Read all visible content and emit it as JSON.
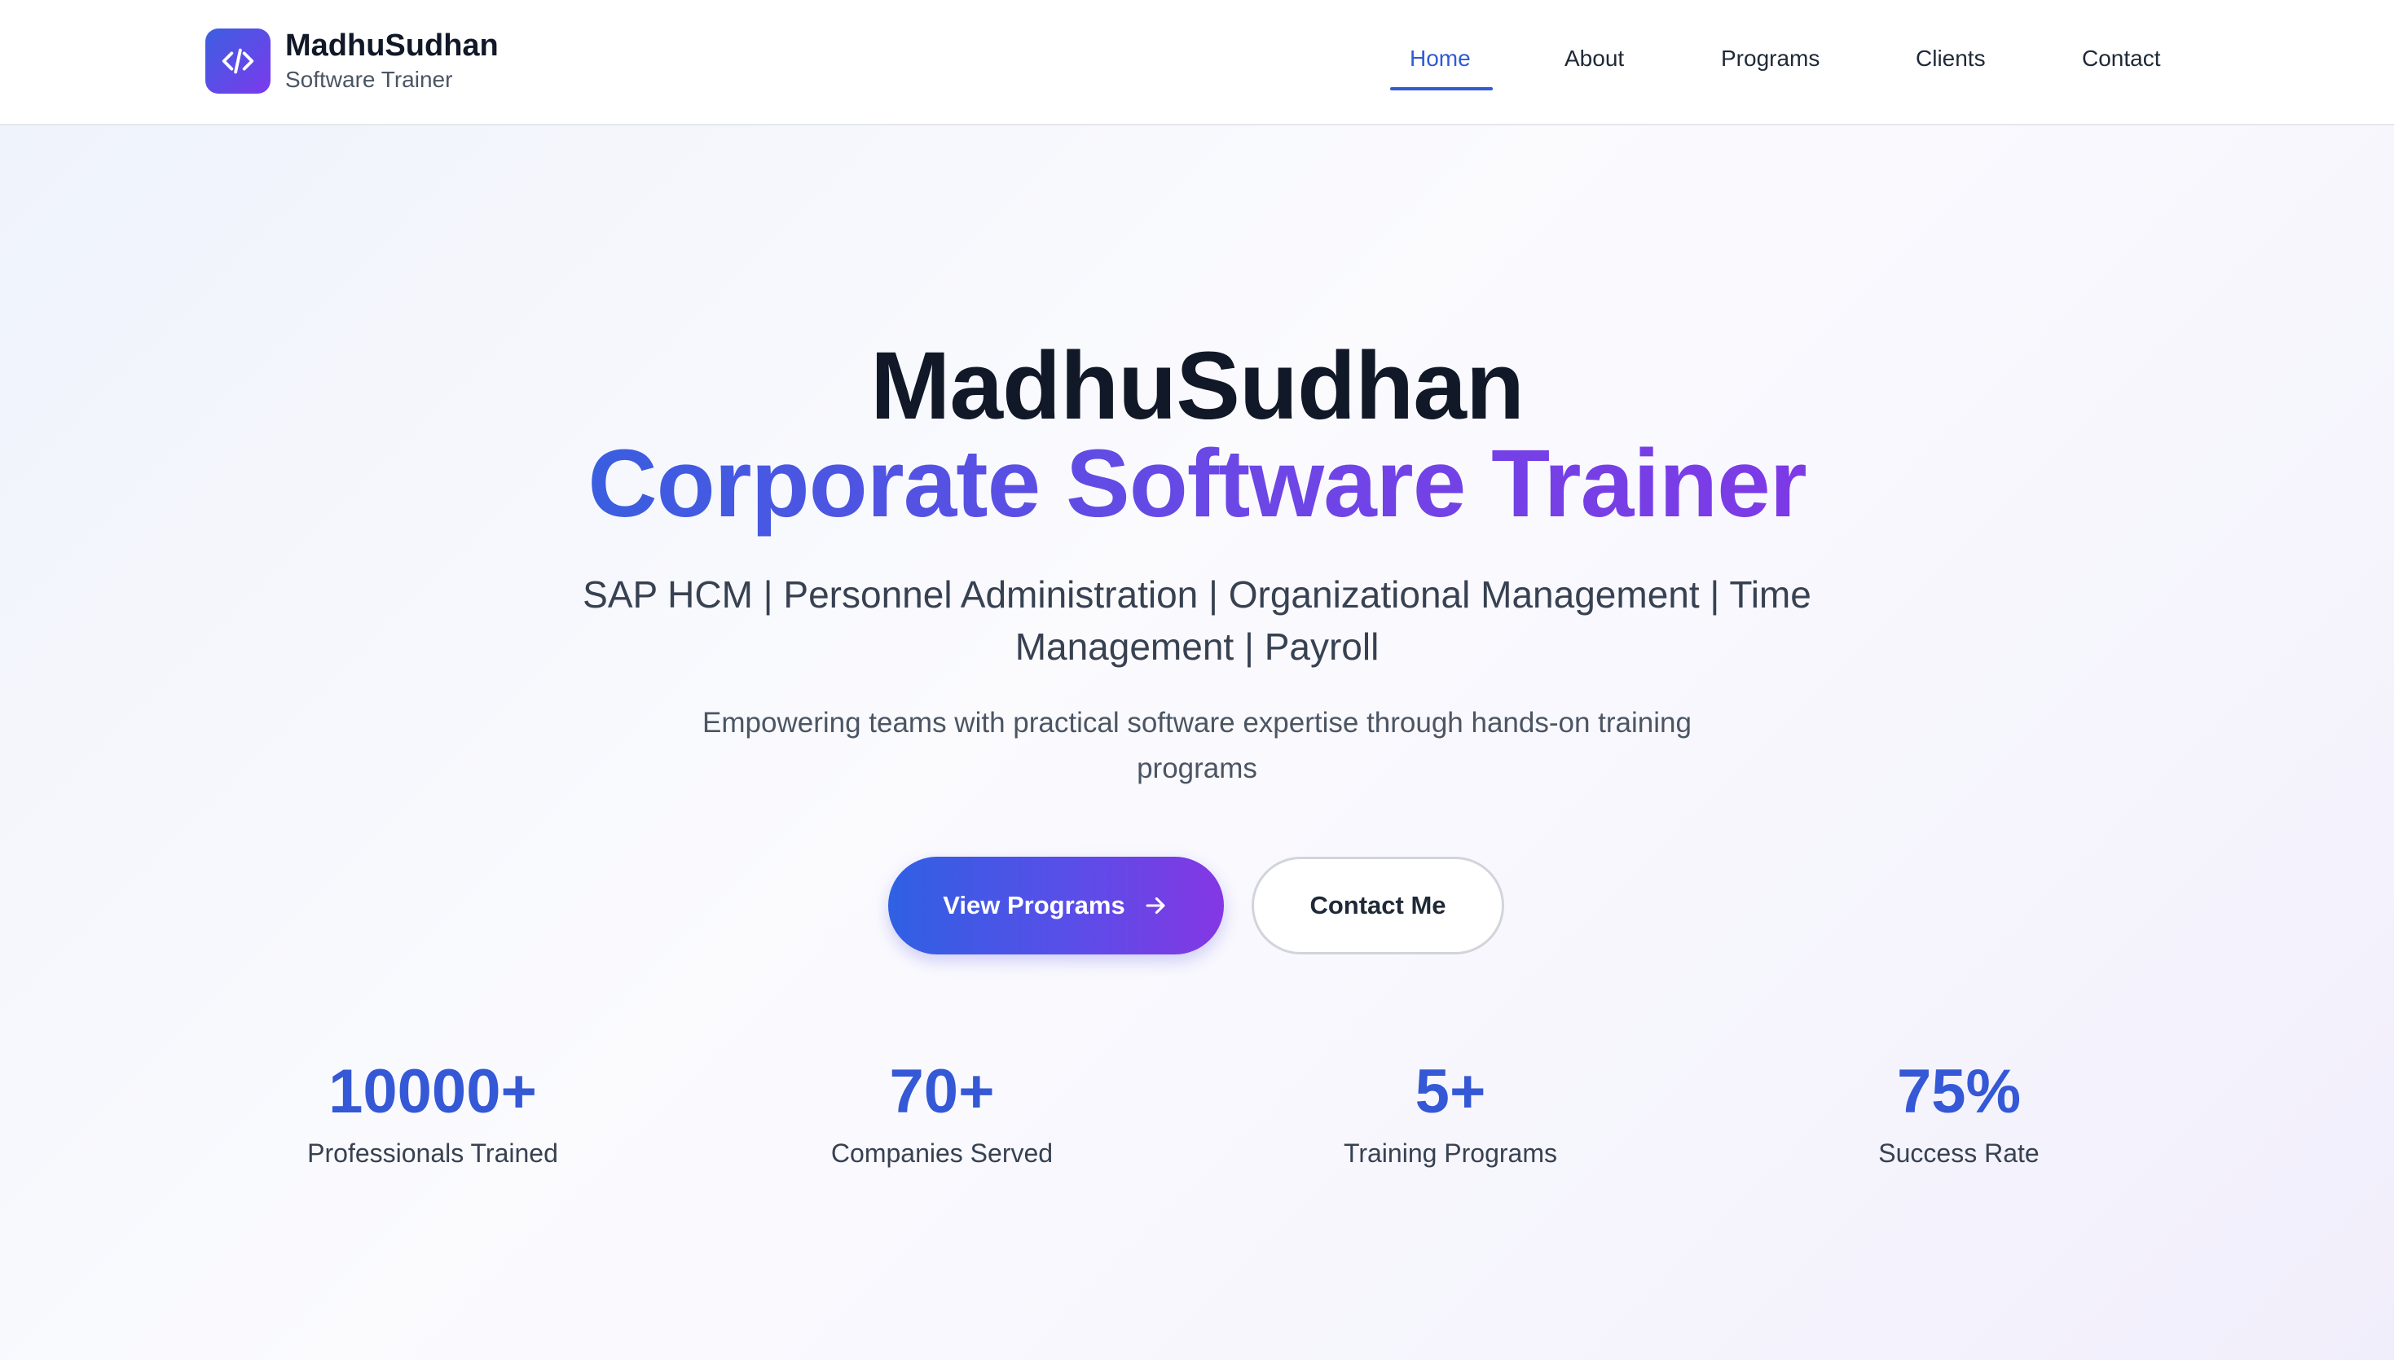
{
  "brand": {
    "name": "MadhuSudhan",
    "subtitle": "Software Trainer",
    "logo_icon": "code-icon",
    "accent_gradient": [
      "#3b5fe0",
      "#7c3aed"
    ]
  },
  "nav": {
    "items": [
      {
        "label": "Home",
        "active": true
      },
      {
        "label": "About",
        "active": false
      },
      {
        "label": "Programs",
        "active": false
      },
      {
        "label": "Clients",
        "active": false
      },
      {
        "label": "Contact",
        "active": false
      }
    ],
    "active_color": "#2f5bd6"
  },
  "hero": {
    "title": "MadhuSudhan",
    "subtitle": "Corporate Software Trainer",
    "specialties": "SAP HCM | Personnel Administration | Organizational Management | Time Management | Payroll",
    "tagline": "Empowering teams with practical software expertise through hands-on training programs",
    "primary_button": {
      "label": "View Programs",
      "icon": "arrow-right-icon"
    },
    "secondary_button": {
      "label": "Contact Me"
    }
  },
  "stats": [
    {
      "value": "10000+",
      "label": "Professionals Trained"
    },
    {
      "value": "70+",
      "label": "Companies Served"
    },
    {
      "value": "5+",
      "label": "Training Programs"
    },
    {
      "value": "75%",
      "label": "Success Rate"
    }
  ]
}
